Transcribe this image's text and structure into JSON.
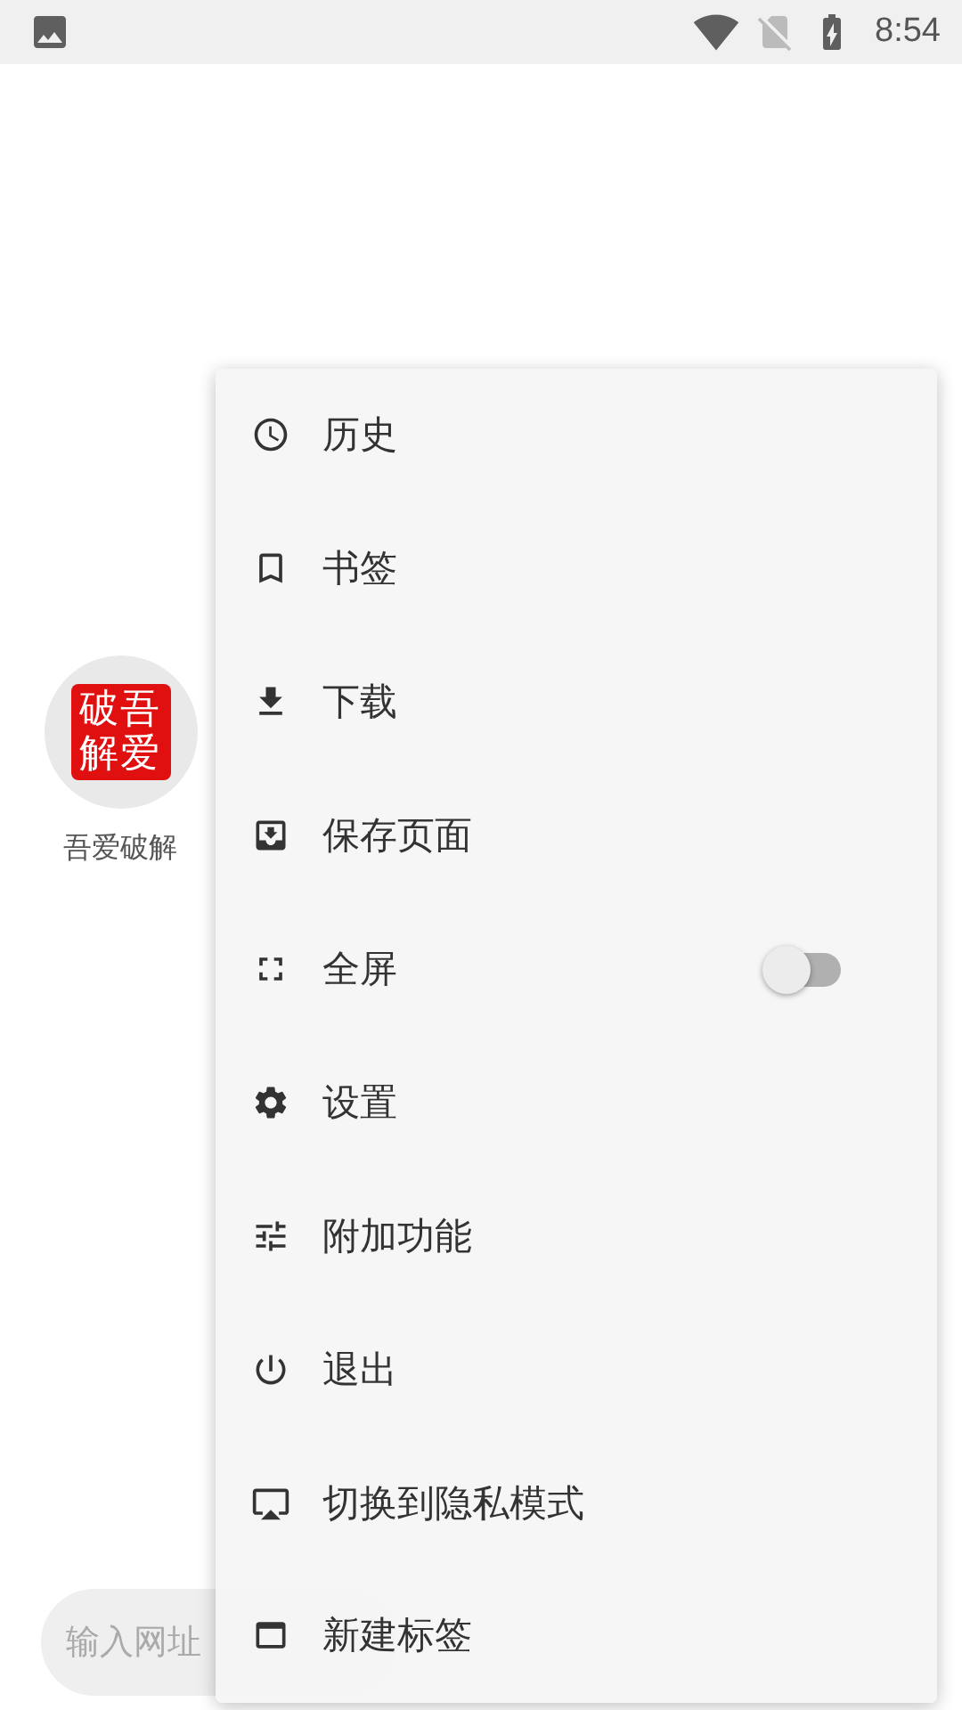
{
  "status_bar": {
    "time": "8:54"
  },
  "shortcuts": [
    {
      "label": "吾爱破解",
      "logo_lines": [
        "破吾",
        "解爱"
      ]
    }
  ],
  "search": {
    "placeholder": "输入网址"
  },
  "menu": {
    "items": [
      {
        "label": "历史",
        "kind": "plain"
      },
      {
        "label": "书签",
        "kind": "plain"
      },
      {
        "label": "下载",
        "kind": "plain"
      },
      {
        "label": "保存页面",
        "kind": "plain"
      },
      {
        "label": "全屏",
        "kind": "toggle",
        "on": false
      },
      {
        "label": "设置",
        "kind": "plain"
      },
      {
        "label": "附加功能",
        "kind": "plain"
      },
      {
        "label": "退出",
        "kind": "plain"
      },
      {
        "label": "切换到隐私模式",
        "kind": "plain"
      },
      {
        "label": "新建标签",
        "kind": "plain"
      }
    ]
  }
}
